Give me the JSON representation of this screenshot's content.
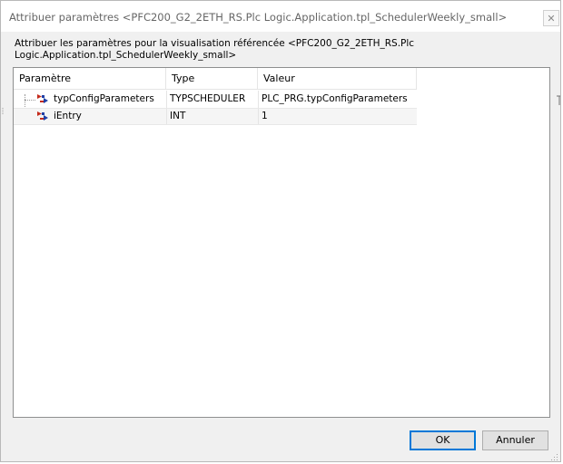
{
  "window": {
    "title": "Attribuer paramètres <PFC200_G2_2ETH_RS.Plc Logic.Application.tpl_SchedulerWeekly_small>",
    "close_glyph": "✕"
  },
  "description": "Attribuer les paramètres pour la visualisation référencée  <PFC200_G2_2ETH_RS.Plc Logic.Application.tpl_SchedulerWeekly_small>",
  "table": {
    "columns": [
      "Paramètre",
      "Type",
      "Valeur"
    ],
    "rows": [
      {
        "name": "typConfigParameters",
        "type": "TYPSCHEDULER",
        "value": "PLC_PRG.typConfigParameters",
        "icon": "variable-icon"
      },
      {
        "name": "iEntry",
        "type": "INT",
        "value": "1",
        "icon": "variable-icon"
      }
    ]
  },
  "buttons": {
    "ok": "OK",
    "cancel": "Annuler"
  },
  "colors": {
    "accent": "#0078d7",
    "icon_red": "#c42b1c",
    "icon_blue": "#1f3fa6"
  }
}
